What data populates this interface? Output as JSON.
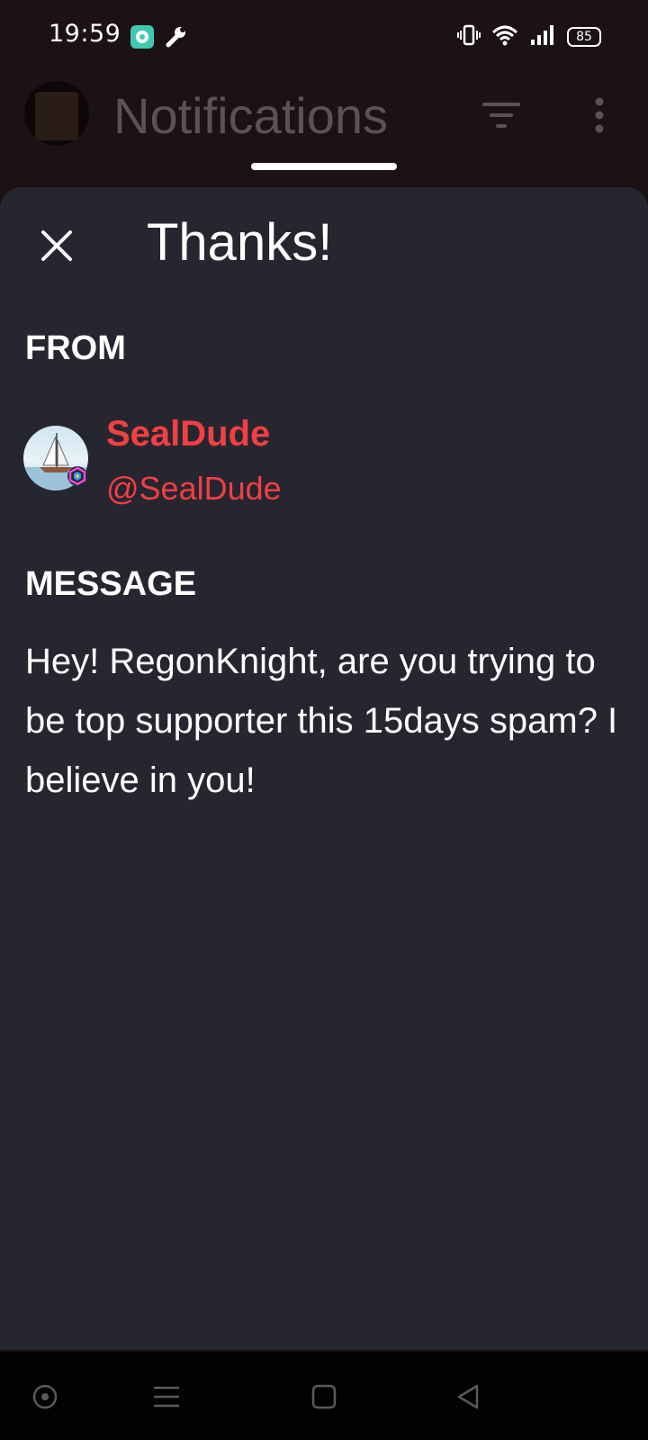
{
  "status_bar": {
    "time": "19:59",
    "battery": "85",
    "icons": [
      "app-notification-icon",
      "wrench-icon",
      "vibrate-icon",
      "wifi-icon",
      "signal-icon",
      "battery-icon"
    ]
  },
  "header": {
    "title": "Notifications"
  },
  "sheet": {
    "title": "Thanks!",
    "from_label": "FROM",
    "sender": {
      "name": "SealDude",
      "handle": "@SealDude",
      "color": "#f23f43"
    },
    "message_label": "MESSAGE",
    "message": "Hey! RegonKnight, are you trying to be top supporter this 15days spam? I believe in you!"
  },
  "colors": {
    "sheet_background": "#262630",
    "backdrop": "#1c1215",
    "accent": "#f23f43"
  },
  "nav_bar": {
    "buttons": [
      "assistant-icon",
      "recents-icon",
      "home-icon",
      "back-icon"
    ]
  }
}
